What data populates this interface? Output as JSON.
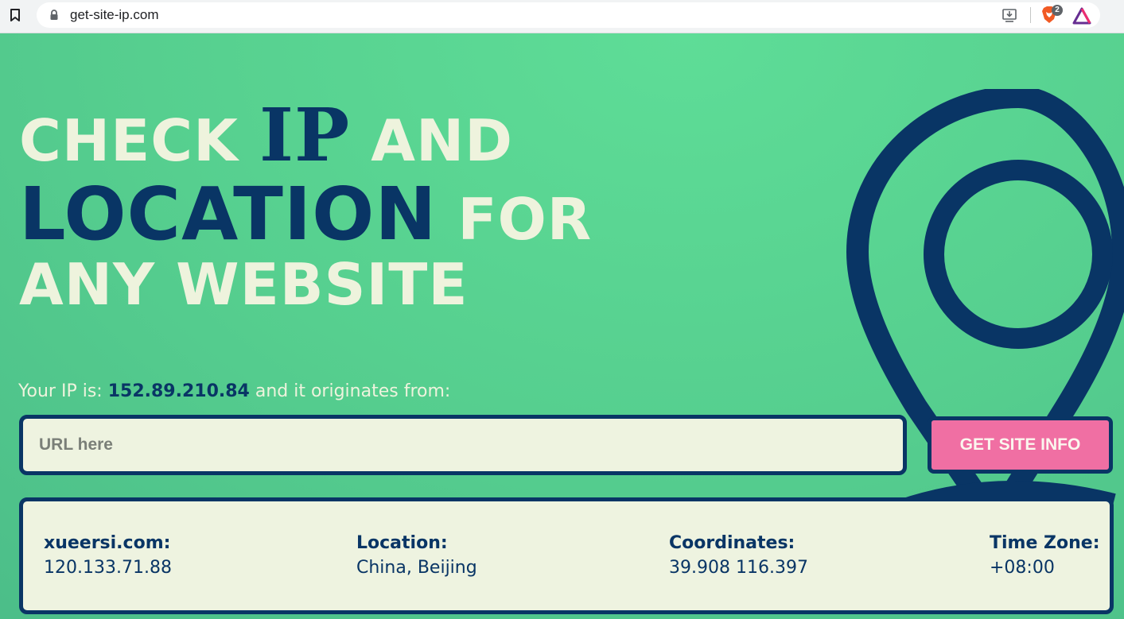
{
  "browser": {
    "url": "get-site-ip.com",
    "brave_shields_count": "2"
  },
  "hero": {
    "line1_a": "CHECK",
    "line1_ip": "IP",
    "line1_b": "AND",
    "line2_location": "LOCATION",
    "line2_b": "FOR",
    "line3": "ANY WEBSITE"
  },
  "your_ip": {
    "prefix": "Your IP is:",
    "ip": "152.89.210.84",
    "suffix": "and it originates from:"
  },
  "search": {
    "placeholder": "URL here",
    "value": "",
    "button_label": "GET SITE INFO"
  },
  "result": {
    "domain_label": "xueersi.com:",
    "domain_ip": "120.133.71.88",
    "location_label": "Location:",
    "location_value": "China, Beijing",
    "coordinates_label": "Coordinates:",
    "coordinates_value": "39.908 116.397",
    "timezone_label": "Time Zone:",
    "timezone_value": "+08:00"
  },
  "colors": {
    "background": "#5dd794",
    "navy": "#093565",
    "cream": "#eef3dd",
    "button": "#f06fa3"
  },
  "icons": [
    "bookmark-icon",
    "lock-icon",
    "install-icon",
    "brave-icon",
    "brave-rewards-icon",
    "location-pin-icon"
  ]
}
